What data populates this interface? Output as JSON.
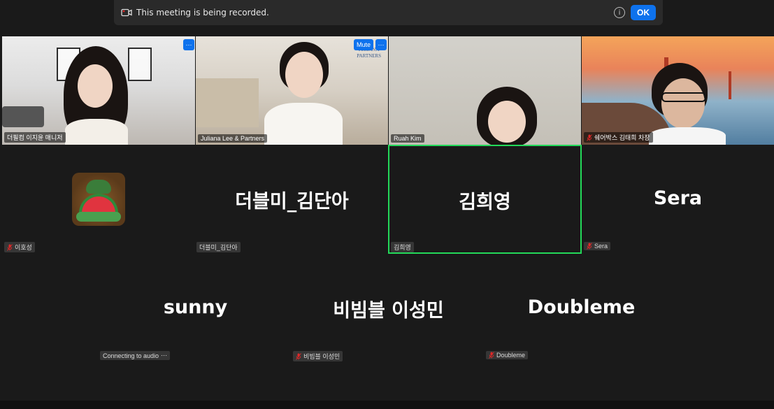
{
  "banner": {
    "text": "This meeting is being recorded.",
    "ok_label": "OK",
    "info_glyph": "i",
    "icon": "record-video-icon"
  },
  "video_tiles": [
    {
      "name": "더필컴 이지윤 매니저",
      "has_more": true
    },
    {
      "name": "Juliana Lee & Partners",
      "has_more": true,
      "mute_label": "Mute",
      "background_text": [
        "JULIANA",
        "PARTNERS"
      ]
    },
    {
      "name": "Ruah Kim",
      "has_more": false
    },
    {
      "name": "쉐어박스 김태희 차장",
      "has_more": false,
      "muted": true
    }
  ],
  "more_glyph": "···",
  "name_tiles_row1": [
    {
      "display": "",
      "tag": "이호성",
      "muted": true,
      "avatar": "watermelon-avatar"
    },
    {
      "display": "더블미_김단아",
      "tag": "더블미_김단아",
      "muted": false
    },
    {
      "display": "김희영",
      "tag": "김희영",
      "muted": false,
      "active": true
    },
    {
      "display": "Sera",
      "tag": "Sera",
      "muted": true
    }
  ],
  "name_tiles_row2": [
    {
      "display": "sunny",
      "tag": "Connecting to audio",
      "connecting": true
    },
    {
      "display": "비빔블 이성민",
      "tag": "비빔블 이성민",
      "muted": true
    },
    {
      "display": "Doubleme",
      "tag": "Doubleme",
      "muted": true
    }
  ],
  "colors": {
    "accent": "#0e72ed",
    "active_speaker": "#23d959",
    "background": "#1a1a1a",
    "muted_mic": "#e02828"
  }
}
